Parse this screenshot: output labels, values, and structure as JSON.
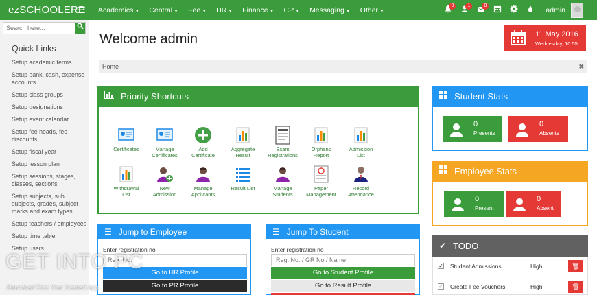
{
  "brand": "ezSCHOOLERP",
  "menu": [
    {
      "label": "Academics"
    },
    {
      "label": "Central"
    },
    {
      "label": "Fee"
    },
    {
      "label": "HR"
    },
    {
      "label": "Finance"
    },
    {
      "label": "CP"
    },
    {
      "label": "Messaging"
    },
    {
      "label": "Other"
    }
  ],
  "topnav": {
    "alerts_badge": "0",
    "users_badge": "1",
    "messages_badge": "0",
    "username": "admin"
  },
  "sidebar": {
    "search_placeholder": "Search here...",
    "title": "Quick Links",
    "links": [
      "Setup academic terms",
      "Setup bank, cash, expense accounts",
      "Setup class groups",
      "Setup designations",
      "Setup event calendar",
      "Setup fee heads, fee discounts",
      "Setup fiscal year",
      "Setup lesson plan",
      "Setup sessions, stages, classes, sections",
      "Setup subjects, sub subjects, grades, subject marks and exam types",
      "Setup teachers / employees",
      "Setup time table",
      "Setup users"
    ]
  },
  "page": {
    "title": "Welcome admin",
    "date": "11 May 2016",
    "datetime": "Wednesday, 10:55",
    "breadcrumb": "Home"
  },
  "priority": {
    "title": "Priority Shortcuts",
    "items": [
      [
        "Certificates",
        "",
        "certificate-icon"
      ],
      [
        "Manage",
        "Certificates",
        "certificate-icon"
      ],
      [
        "Add",
        "Certificate",
        "plus-circle-icon"
      ],
      [
        "Aggregate",
        "Result",
        "bar-chart-icon"
      ],
      [
        "Exam",
        "Registrations",
        "document-icon"
      ],
      [
        "Orphans",
        "Report",
        "bar-chart-icon"
      ],
      [
        "Admission",
        "List",
        "bar-chart-icon"
      ],
      [
        "Withdrawal",
        "List",
        "bar-chart-icon"
      ],
      [
        "New",
        "Admission",
        "user-add-icon"
      ],
      [
        "Manage",
        "Applicants",
        "user-icon"
      ],
      [
        "Result List",
        "",
        "list-icon"
      ],
      [
        "Manage",
        "Students",
        "user-icon"
      ],
      [
        "Paper",
        "Management",
        "paper-icon"
      ],
      [
        "Record",
        "Attendance",
        "teacher-icon"
      ]
    ]
  },
  "student_stats": {
    "title": "Student Stats",
    "presents_value": "0",
    "presents_label": "Presents",
    "absents_value": "0",
    "absents_label": "Absents"
  },
  "employee_stats": {
    "title": "Employee Stats",
    "present_value": "0",
    "present_label": "Present",
    "absent_value": "0",
    "absent_label": "Absent"
  },
  "jump_employee": {
    "title": "Jump to Employee",
    "label": "Enter registration no",
    "placeholder": "Reg. No.",
    "btn_hr": "Go to HR Profile",
    "btn_pr": "Go to PR Profile"
  },
  "jump_student": {
    "title": "Jump To Student",
    "label": "Enter registration no",
    "placeholder": "Reg. No. / GR No / Name",
    "btn_profile": "Go to Student Profile",
    "btn_result": "Go to Result Profile"
  },
  "todo": {
    "title": "TODO",
    "items": [
      {
        "text": "Student Admissions",
        "priority": "High"
      },
      {
        "text": "Create Fee Vouchers",
        "priority": "High"
      }
    ]
  },
  "watermark": {
    "main": "GET INTO PC",
    "sub": "Download Free Your Desired App"
  },
  "colors": {
    "green": "#3a9c3a",
    "blue": "#2196f3",
    "orange": "#f5a623",
    "red": "#e53935",
    "gray": "#616161"
  }
}
